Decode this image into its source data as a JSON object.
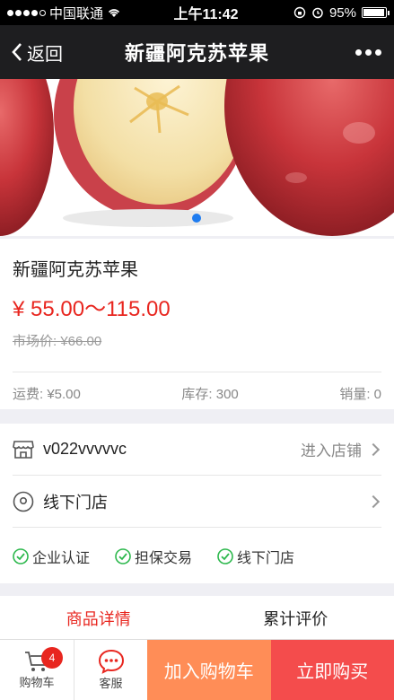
{
  "statusbar": {
    "carrier": "中国联通",
    "time": "上午11:42",
    "battery": "95%",
    "battery_level": 0.95
  },
  "navbar": {
    "back_label": "返回",
    "title": "新疆阿克苏苹果"
  },
  "hero": {
    "image_name": "apple-photo",
    "carousel_active_index": 0
  },
  "product": {
    "name": "新疆阿克苏苹果",
    "price": "¥ 55.00～115.00",
    "market_price": "市场价: ¥66.00",
    "shipping": "运费: ¥5.00",
    "stock": "库存: 300",
    "sales": "销量: 0"
  },
  "store": {
    "name": "v022vvvvvc",
    "enter_label": "进入店铺",
    "offline_store_label": "线下门店",
    "badges": [
      "企业认证",
      "担保交易",
      "线下门店"
    ]
  },
  "tabs": [
    {
      "label": "商品详情",
      "active": true
    },
    {
      "label": "累计评价",
      "active": false
    }
  ],
  "bottom": {
    "cart_label": "购物车",
    "cart_count": "4",
    "service_label": "客服",
    "add_to_cart": "加入购物车",
    "buy_now": "立即购买"
  },
  "colors": {
    "accent_red": "#e8261f",
    "cart_button": "#ff8d57",
    "buy_button": "#f44c4c",
    "indicator_blue": "#1e7cf0",
    "check_green": "#2db84d"
  }
}
